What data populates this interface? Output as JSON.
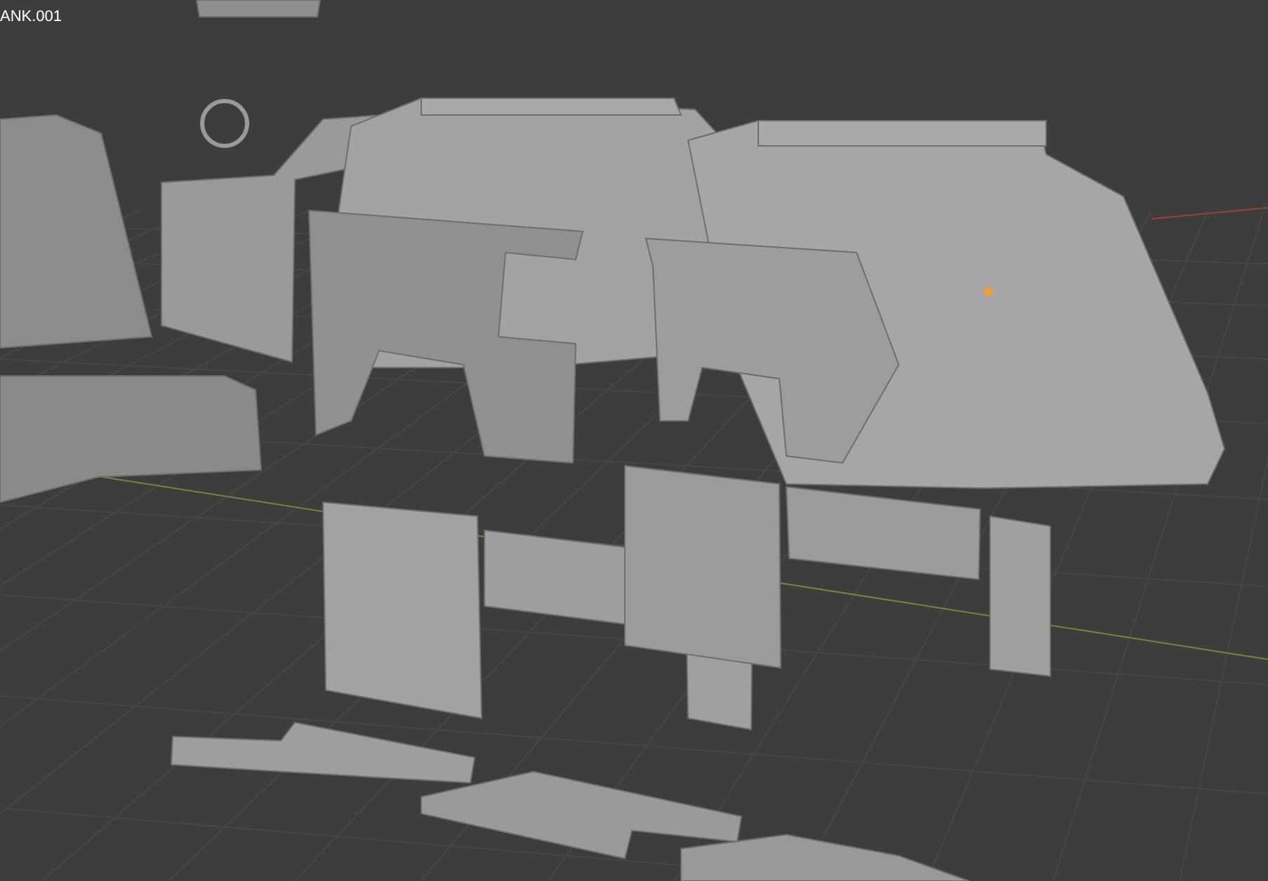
{
  "viewport": {
    "object_label": "ANK.001"
  }
}
